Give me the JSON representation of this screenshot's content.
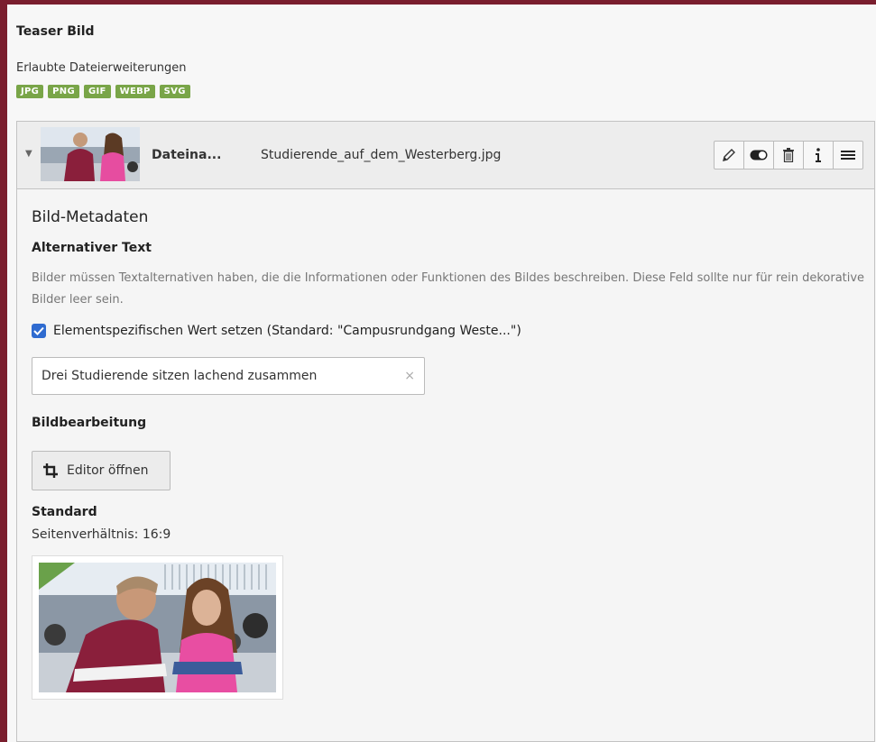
{
  "field": {
    "title": "Teaser Bild",
    "extensions_label": "Erlaubte Dateierweiterungen",
    "extensions": [
      "JPG",
      "PNG",
      "GIF",
      "WEBP",
      "SVG"
    ]
  },
  "file": {
    "name_label": "Dateina...",
    "name": "Studierende_auf_dem_Westerberg.jpg",
    "toolbar_icons": [
      "pencil-icon",
      "toggle-icon",
      "trash-icon",
      "info-icon",
      "menu-icon"
    ]
  },
  "metadata": {
    "title": "Bild-Metadaten",
    "alt_label": "Alternativer Text",
    "alt_description": "Bilder müssen Textalternativen haben, die die Informationen oder Funktionen des Bildes beschreiben. Diese Feld sollte nur für rein dekorative Bilder leer sein.",
    "override_label": "Elementspezifischen Wert setzen (Standard: \"Campusrundgang Weste...\")",
    "override_checked": true,
    "alt_value": "Drei Studierende sitzen lachend zusammen",
    "clear_symbol": "×"
  },
  "editing": {
    "label": "Bildbearbeitung",
    "editor_button": "Editor öffnen",
    "crop_label": "Standard",
    "ratio": "Seitenverhältnis: 16:9"
  },
  "colors": {
    "frame": "#7a1e2e",
    "badge": "#79a548",
    "checkbox": "#2f6bd0"
  }
}
